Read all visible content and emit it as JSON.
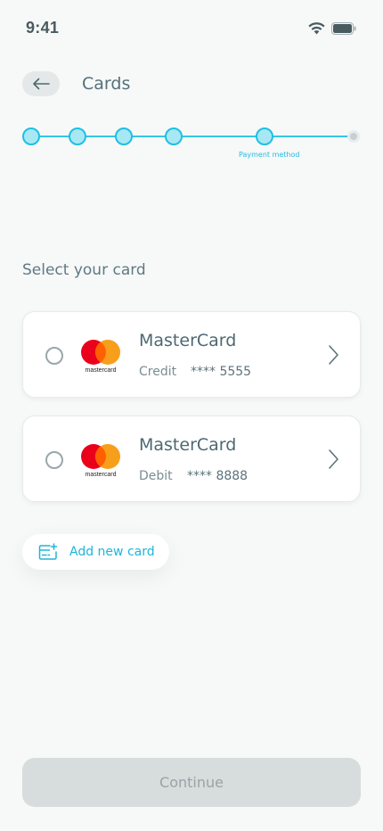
{
  "status_bar": {
    "time": "9:41"
  },
  "header": {
    "title": "Cards"
  },
  "stepper": {
    "current_step_label": "Payment method"
  },
  "section": {
    "label": "Select your card"
  },
  "cards": [
    {
      "brand": "MasterCard",
      "type": "Credit",
      "number": "**** 5555",
      "logo_text": "mastercard"
    },
    {
      "brand": "MasterCard",
      "type": "Debit",
      "number": "**** 8888",
      "logo_text": "mastercard"
    }
  ],
  "add_card": {
    "label": "Add new card"
  },
  "footer": {
    "continue_label": "Continue"
  },
  "colors": {
    "accent": "#1fc0e3",
    "mc_red": "#eb001b",
    "mc_orange": "#f79e1b"
  }
}
